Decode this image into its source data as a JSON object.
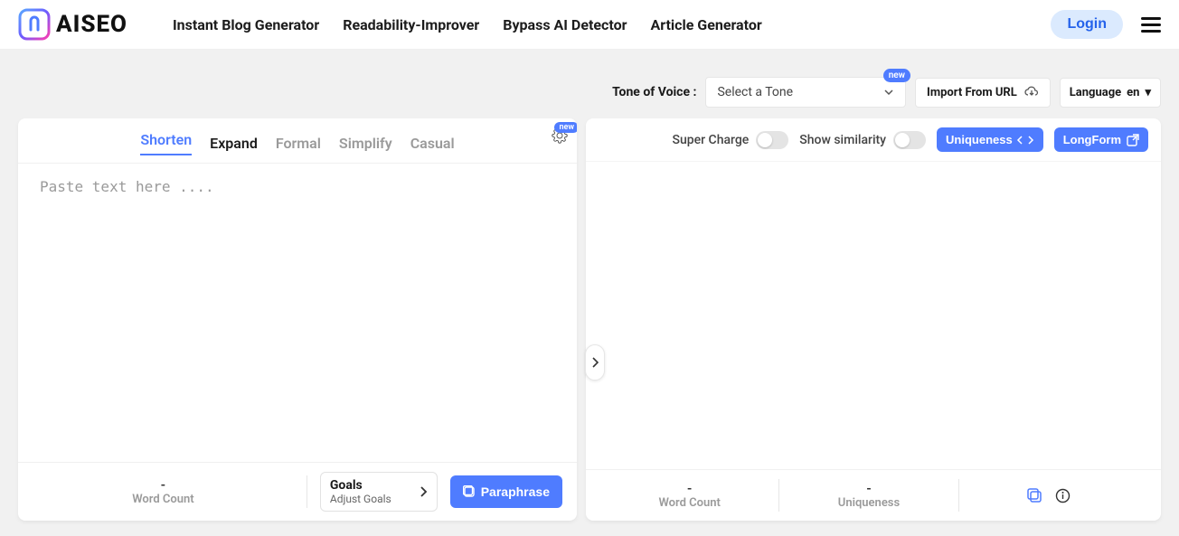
{
  "brand": "AISEO",
  "nav": {
    "items": [
      "Instant Blog Generator",
      "Readability-Improver",
      "Bypass AI Detector",
      "Article Generator"
    ]
  },
  "login": "Login",
  "tone": {
    "label": "Tone of Voice :",
    "selected": "Select a Tone",
    "badge": "new"
  },
  "import_url": "Import From URL",
  "language": {
    "label": "Language",
    "value": "en"
  },
  "tabs": [
    "Shorten",
    "Expand",
    "Formal",
    "Simplify",
    "Casual"
  ],
  "gear_badge": "new",
  "editor": {
    "placeholder": "Paste text here ...."
  },
  "left_footer": {
    "wordcount": {
      "value": "-",
      "label": "Word Count"
    },
    "goals": {
      "title": "Goals",
      "sub": "Adjust Goals"
    },
    "paraphrase": "Paraphrase"
  },
  "right_top": {
    "supercharge": "Super Charge",
    "similarity": "Show similarity",
    "uniqueness": "Uniqueness",
    "longform": "LongForm"
  },
  "right_footer": {
    "wordcount": {
      "value": "-",
      "label": "Word Count"
    },
    "uniqueness": {
      "value": "-",
      "label": "Uniqueness"
    }
  }
}
